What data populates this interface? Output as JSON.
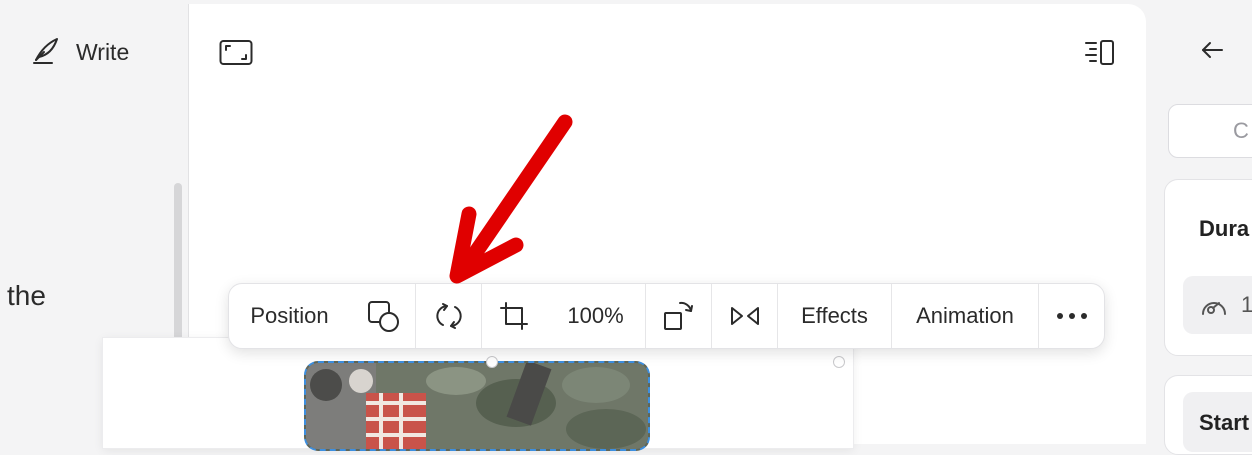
{
  "left_panel": {
    "write_label": "Write",
    "body_text_fragment": "the"
  },
  "toolbar": {
    "position_label": "Position",
    "zoom_value": "100%",
    "effects_label": "Effects",
    "animation_label": "Animation"
  },
  "right_panel": {
    "search_placeholder_fragment": "C",
    "duration_label_fragment": "Dura",
    "duration_value_fragment": "1",
    "start_label_fragment": "Start"
  },
  "annotation": {
    "arrow_color": "#e00000"
  },
  "colors": {
    "selection": "#3d8fe0",
    "toolbar_bg": "#ffffff",
    "app_bg": "#f4f4f5"
  }
}
